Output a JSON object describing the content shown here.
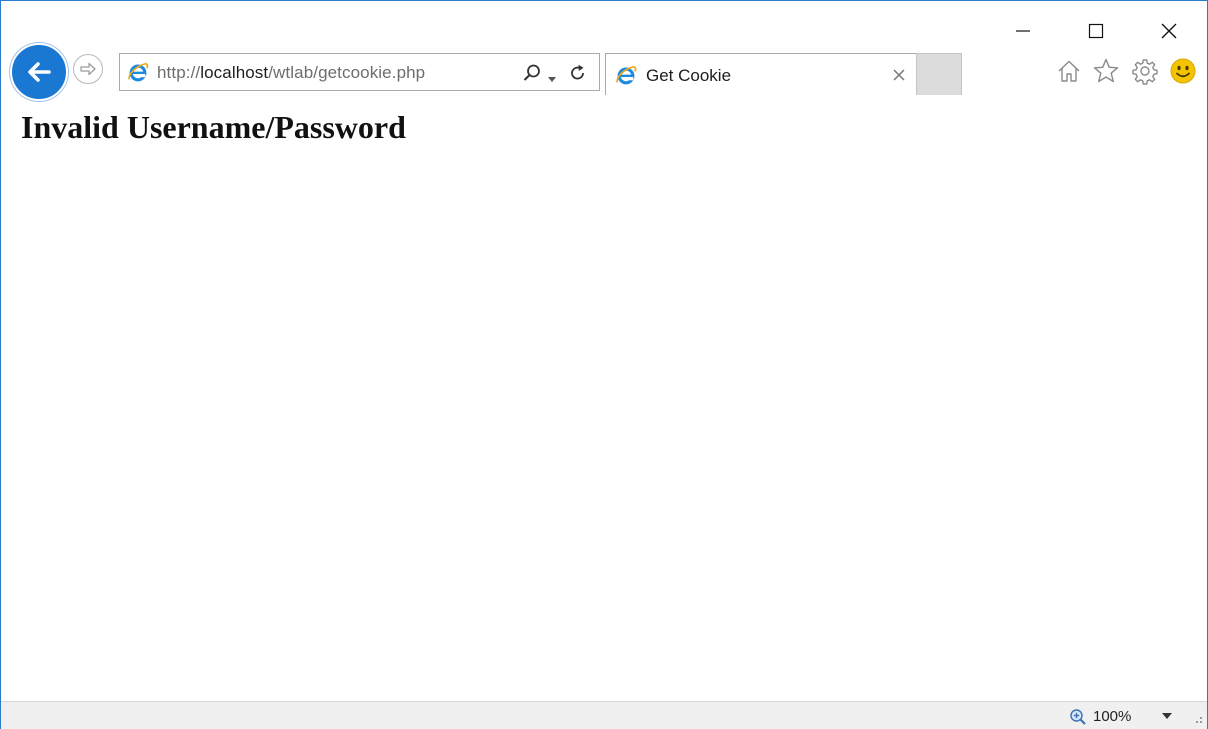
{
  "window": {
    "minimize_label": "Minimize",
    "maximize_label": "Maximize",
    "close_label": "Close"
  },
  "navigation": {
    "back_icon": "back-arrow-icon",
    "forward_icon": "forward-arrow-icon"
  },
  "address_bar": {
    "url_scheme": "http://",
    "url_host": "localhost",
    "url_path": "/wtlab/getcookie.php",
    "search_icon": "search-icon",
    "dropdown_icon": "chevron-down-icon",
    "refresh_icon": "refresh-icon"
  },
  "tab": {
    "title": "Get Cookie",
    "close_icon": "close-icon"
  },
  "toolbar": {
    "icons": [
      "home-icon",
      "favorites-star-icon",
      "settings-gear-icon",
      "feedback-smiley-icon"
    ]
  },
  "page": {
    "heading": "Invalid Username/Password"
  },
  "status_bar": {
    "zoom_level": "100%",
    "zoom_icon": "zoom-magnifier-icon"
  },
  "colors": {
    "accent": "#1a77d2",
    "window_border": "#2b7bcf",
    "status_bar_bg": "#f0f0f0"
  }
}
